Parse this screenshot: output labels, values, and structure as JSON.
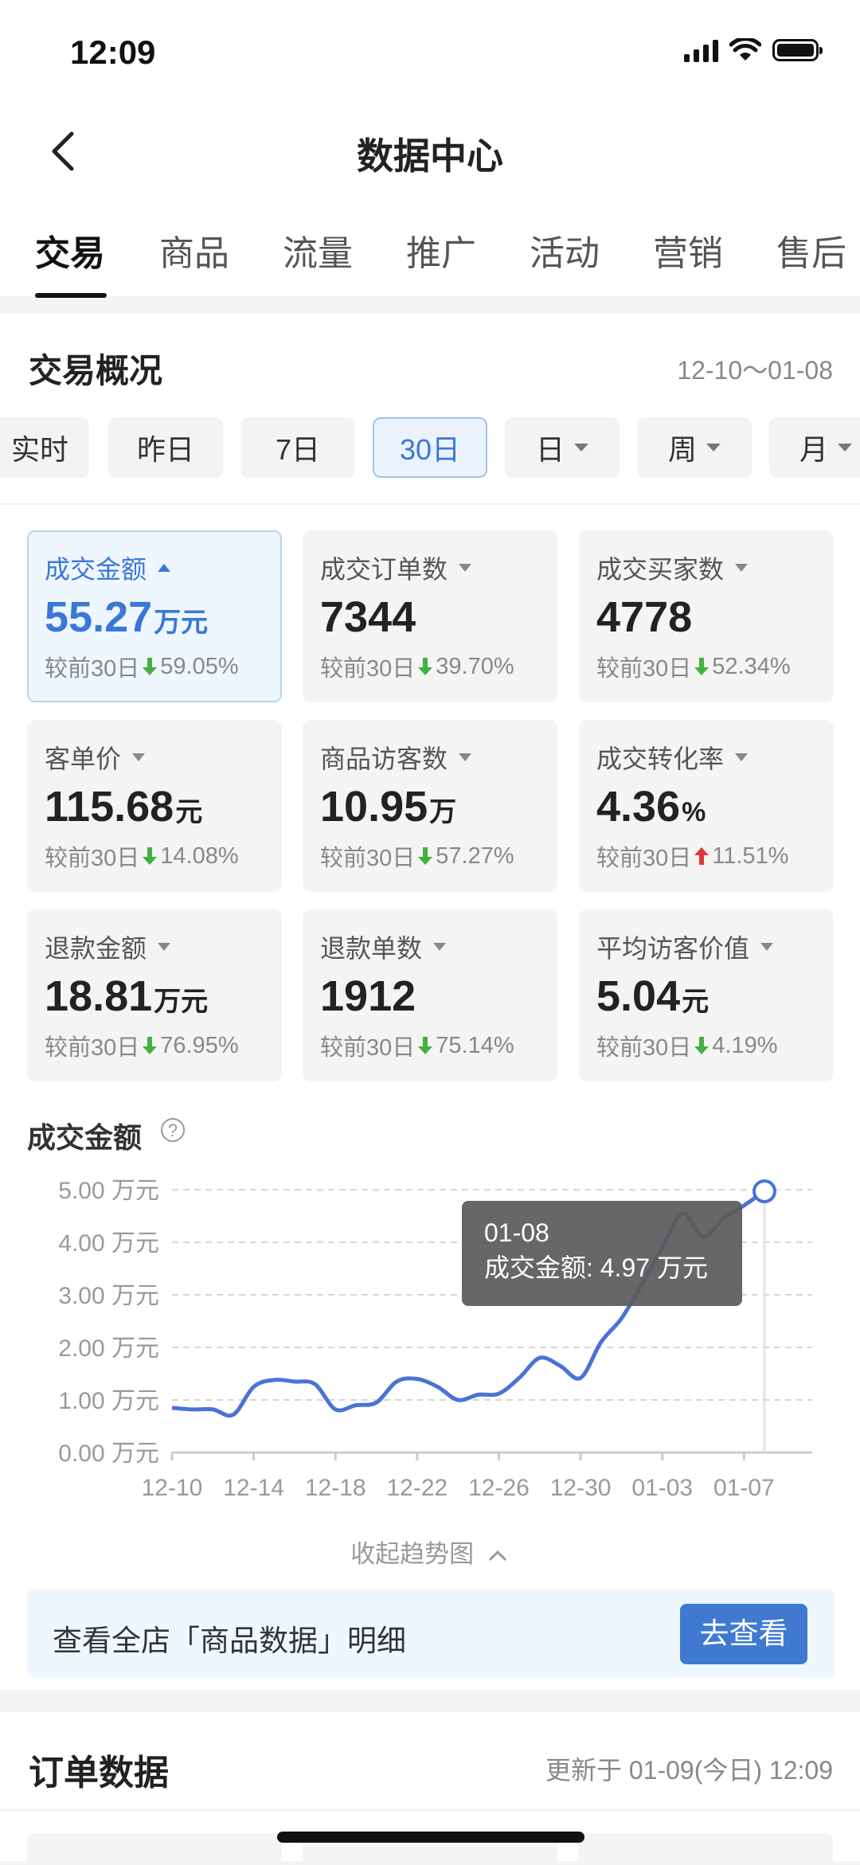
{
  "status_bar": {
    "time": "12:09"
  },
  "header": {
    "title": "数据中心"
  },
  "tabs": [
    "交易",
    "商品",
    "流量",
    "推广",
    "活动",
    "营销",
    "售后"
  ],
  "overview": {
    "title": "交易概况",
    "date_range": "12-10～01-08",
    "periods": [
      "实时",
      "昨日",
      "7日",
      "30日",
      "日",
      "周",
      "月"
    ],
    "selected_period": "30日"
  },
  "metrics": [
    {
      "label": "成交金额",
      "value": "55.27",
      "unit": "万元",
      "compare": "较前30日",
      "direction": "down",
      "change": "59.05%"
    },
    {
      "label": "成交订单数",
      "value": "7344",
      "unit": "",
      "compare": "较前30日",
      "direction": "down",
      "change": "39.70%"
    },
    {
      "label": "成交买家数",
      "value": "4778",
      "unit": "",
      "compare": "较前30日",
      "direction": "down",
      "change": "52.34%"
    },
    {
      "label": "客单价",
      "value": "115.68",
      "unit": "元",
      "compare": "较前30日",
      "direction": "down",
      "change": "14.08%"
    },
    {
      "label": "商品访客数",
      "value": "10.95",
      "unit": "万",
      "compare": "较前30日",
      "direction": "down",
      "change": "57.27%"
    },
    {
      "label": "成交转化率",
      "value": "4.36",
      "unit": "%",
      "compare": "较前30日",
      "direction": "up",
      "change": "11.51%"
    },
    {
      "label": "退款金额",
      "value": "18.81",
      "unit": "万元",
      "compare": "较前30日",
      "direction": "down",
      "change": "76.95%"
    },
    {
      "label": "退款单数",
      "value": "1912",
      "unit": "",
      "compare": "较前30日",
      "direction": "down",
      "change": "75.14%"
    },
    {
      "label": "平均访客价值",
      "value": "5.04",
      "unit": "元",
      "compare": "较前30日",
      "direction": "down",
      "change": "4.19%"
    }
  ],
  "colors": {
    "accent": "#3a78d6",
    "down": "#43b040",
    "up": "#e0382f",
    "line": "#4a72d8"
  },
  "chart_title": "成交金额",
  "tooltip": {
    "date": "01-08",
    "text": "成交金额: 4.97 万元"
  },
  "collapse_label": "收起趋势图",
  "banner": {
    "text": "查看全店「商品数据」明细",
    "button": "去查看"
  },
  "order_section": {
    "title": "订单数据",
    "updated": "更新于 01-09(今日) 12:09"
  },
  "chart_data": {
    "type": "line",
    "title": "成交金额",
    "x": [
      "12-10",
      "12-11",
      "12-12",
      "12-13",
      "12-14",
      "12-15",
      "12-16",
      "12-17",
      "12-18",
      "12-19",
      "12-20",
      "12-21",
      "12-22",
      "12-23",
      "12-24",
      "12-25",
      "12-26",
      "12-27",
      "12-28",
      "12-29",
      "12-30",
      "12-31",
      "01-01",
      "01-02",
      "01-03",
      "01-04",
      "01-05",
      "01-06",
      "01-07",
      "01-08"
    ],
    "x_tick_labels": [
      "12-10",
      "12-14",
      "12-18",
      "12-22",
      "12-26",
      "12-30",
      "01-03",
      "01-07"
    ],
    "y_tick_labels": [
      "0.00 万元",
      "1.00 万元",
      "2.00 万元",
      "3.00 万元",
      "4.00 万元",
      "5.00 万元"
    ],
    "series": [
      {
        "values": [
          0.85,
          0.82,
          0.82,
          0.72,
          1.25,
          1.38,
          1.35,
          1.3,
          0.82,
          0.9,
          0.95,
          1.35,
          1.4,
          1.25,
          1.0,
          1.1,
          1.12,
          1.42,
          1.8,
          1.65,
          1.42,
          2.1,
          2.55,
          3.2,
          3.9,
          4.55,
          4.1,
          4.45,
          4.7,
          4.97
        ]
      }
    ],
    "ylim": [
      0,
      5
    ],
    "grid": true,
    "highlight_index": 29
  }
}
